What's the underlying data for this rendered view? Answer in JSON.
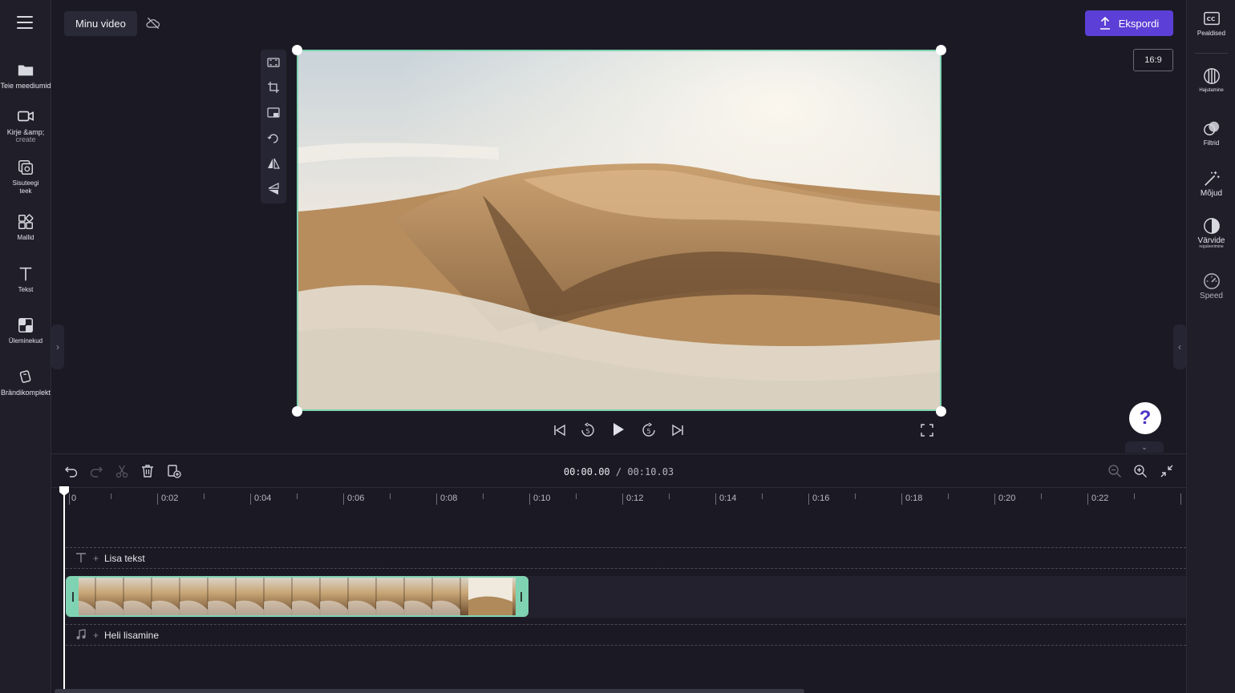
{
  "project": {
    "title": "Minu video"
  },
  "left_sidebar": {
    "items": [
      {
        "label": "Teie meediumid",
        "icon": "folder-icon"
      },
      {
        "label": "Kirje &amp;",
        "sub": "create",
        "icon": "camera-icon"
      },
      {
        "label": "Sisuteegi",
        "sub": "teek",
        "icon": "content-library-icon"
      },
      {
        "label": "Mallid",
        "icon": "templates-icon"
      },
      {
        "label": "Tekst",
        "icon": "text-icon"
      },
      {
        "label": "Üleminekud",
        "icon": "transitions-icon"
      },
      {
        "label": "Brändikomplekt",
        "icon": "brand-kit-icon"
      }
    ]
  },
  "right_sidebar": {
    "items": [
      {
        "label": "Pealdised",
        "icon": "captions-icon"
      },
      {
        "label": "Hajutamine",
        "icon": "fade-icon"
      },
      {
        "label": "Filtrid",
        "icon": "filters-icon"
      },
      {
        "label": "Mõjud",
        "icon": "effects-wand-icon"
      },
      {
        "label": "Värvide",
        "sub": "reguleerimine",
        "icon": "color-adjust-icon"
      },
      {
        "label": "Speed",
        "icon": "speed-icon"
      }
    ]
  },
  "toolbar": {
    "export_label": "Ekspordi",
    "aspect_ratio": "16:9"
  },
  "help": {
    "label": "?"
  },
  "timeline": {
    "current_time": "00:00.00",
    "separator": " / ",
    "total_time": "00:10.03",
    "ruler_labels": [
      "0",
      "0:02",
      "0:04",
      "0:06",
      "0:08",
      "0:10",
      "0:12",
      "0:14",
      "0:16",
      "0:18",
      "0:20",
      "0:22"
    ],
    "text_track_label": "Lisa tekst",
    "audio_track_label": "Heli lisamine",
    "plus": "+"
  },
  "colors": {
    "accent": "#5b3fd6",
    "clip_border": "#7fd3b2",
    "background": "#1b1a24"
  }
}
